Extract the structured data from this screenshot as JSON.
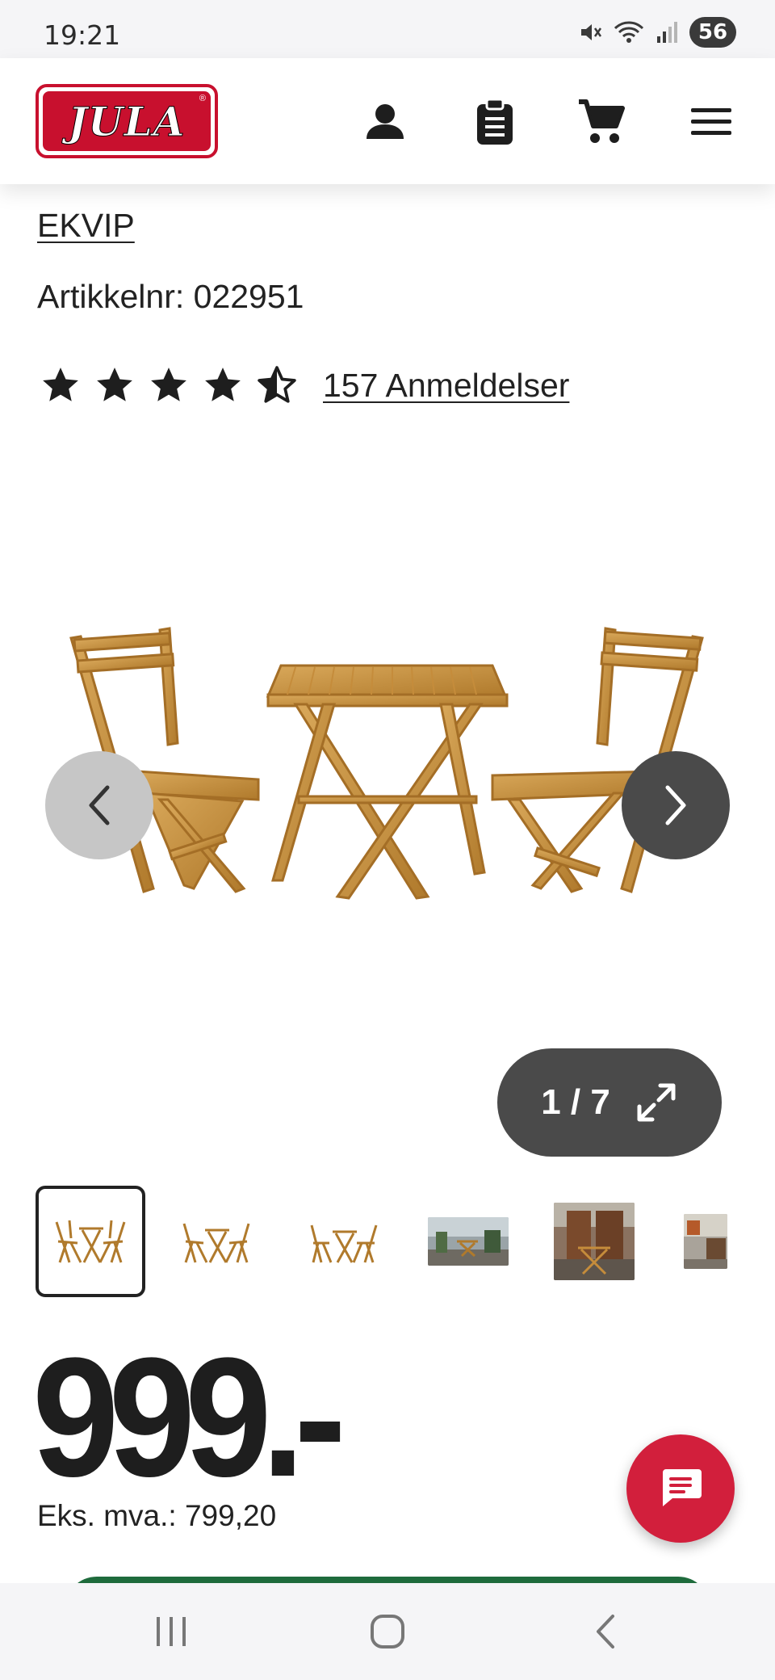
{
  "status_bar": {
    "time": "19:21",
    "battery_level": "56",
    "icons": [
      "mute-icon",
      "wifi-icon",
      "signal-icon",
      "battery-icon"
    ]
  },
  "header": {
    "logo_text": "JULA",
    "logo_mark": "®",
    "icons": [
      "account-icon",
      "shopping-list-icon",
      "cart-icon",
      "menu-icon"
    ]
  },
  "product": {
    "brand": "EKVIP",
    "article_number": "Artikkelnr: 022951",
    "rating": 4.5,
    "rating_max": 5,
    "reviews_label": "157 Anmeldelser"
  },
  "gallery": {
    "counter": "1 / 7",
    "current_index": 1,
    "total": 7,
    "thumbnails": [
      "bistro-set-front",
      "bistro-set-angle",
      "bistro-set-side",
      "bistro-set-patio",
      "bistro-set-terrace",
      "bistro-set-garden"
    ]
  },
  "price": {
    "amount": "999.-",
    "ex_vat": "Eks. mva.: 799,20"
  },
  "colors": {
    "brand_red": "#c8102e",
    "chat_red": "#d21f3c",
    "cta_green": "#1e6b3c",
    "dark_pill": "#4a4a4a"
  }
}
